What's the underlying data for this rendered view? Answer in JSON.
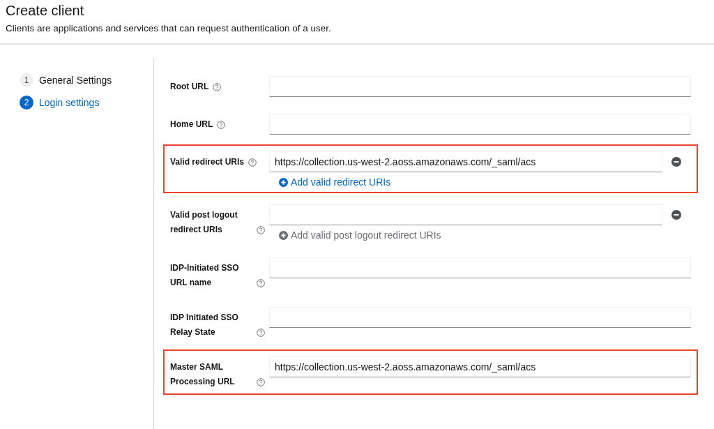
{
  "header": {
    "title": "Create client",
    "description": "Clients are applications and services that can request authentication of a user."
  },
  "steps": [
    {
      "number": "1",
      "label": "General Settings",
      "selected": false
    },
    {
      "number": "2",
      "label": "Login settings",
      "selected": true
    }
  ],
  "fields": [
    {
      "kind": "single",
      "label": "Root URL",
      "highlighted": false
    },
    {
      "kind": "single",
      "label": "Home URL",
      "highlighted": false
    },
    {
      "kind": "multi",
      "label": "Valid redirect URIs",
      "value": "https://collection.us-west-2.aoss.amazonaws.com/_saml/acs",
      "add_label": "Add valid redirect URIs",
      "add_disabled": false,
      "highlighted": true
    },
    {
      "kind": "multi",
      "label": "Valid post logout redirect URIs",
      "add_label": "Add valid post logout redirect URIs",
      "add_disabled": true,
      "highlighted": false
    },
    {
      "kind": "single",
      "label": "IDP-Initiated SSO URL name",
      "highlighted": false
    },
    {
      "kind": "single",
      "label": "IDP Initiated SSO Relay State",
      "highlighted": false
    },
    {
      "kind": "single",
      "label": "Master SAML Processing URL",
      "value": "https://collection.us-west-2.aoss.amazonaws.com/_saml/acs",
      "highlighted": true
    }
  ]
}
